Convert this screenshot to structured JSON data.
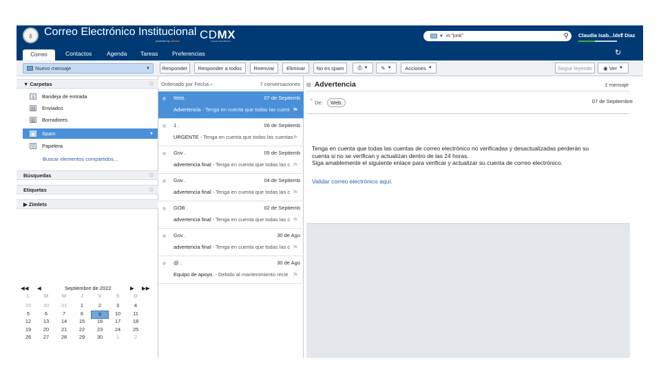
{
  "header": {
    "app_title": "Correo Electrónico Institucional",
    "powered_by": "powered by",
    "powered_brand": "zimbra",
    "cdmx_prefix": "CD",
    "cdmx_bold": "MX",
    "cdmx_sub": "CIUDAD DE MÉXICO",
    "search_value": "in:\"junk\"",
    "user_name": "Claudia Isab...ldez Diaz",
    "colors": {
      "brand": "#003a74",
      "selection": "#4a90d9",
      "link": "#2a5db0"
    }
  },
  "tabs": [
    "Correo",
    "Contactos",
    "Agenda",
    "Tareas",
    "Preferencias"
  ],
  "toolbar": {
    "new_message": "Nuevo mensaje",
    "reply": "Responder",
    "reply_all": "Responder a todos",
    "forward": "Reenviar",
    "delete": "Eliminar",
    "not_spam": "No es spam",
    "actions": "Acciones",
    "keep_reading": "Seguir leyendo",
    "view": "Ver"
  },
  "sidebar": {
    "folders_title": "Carpetas",
    "folders": [
      {
        "label": "Bandeja de entrada",
        "icon": "inbox-icon"
      },
      {
        "label": "Enviados",
        "icon": "sent-icon"
      },
      {
        "label": "Borradores",
        "icon": "drafts-icon"
      },
      {
        "label": "Spam",
        "icon": "spam-icon"
      },
      {
        "label": "Papelera",
        "icon": "trash-icon"
      }
    ],
    "shared": "Buscar elementos compartidos...",
    "searches": "Búsquedas",
    "tags": "Etiquetas",
    "zimlets": "Zimlets"
  },
  "calendar": {
    "month": "Septiembre de 2022",
    "dow": [
      "L",
      "M",
      "M",
      "J",
      "V",
      "S",
      "D"
    ],
    "weeks": [
      [
        "29",
        "30",
        "31",
        "1",
        "2",
        "3",
        "4"
      ],
      [
        "5",
        "6",
        "7",
        "8",
        "9",
        "10",
        "11"
      ],
      [
        "12",
        "13",
        "14",
        "15",
        "16",
        "17",
        "18"
      ],
      [
        "19",
        "20",
        "21",
        "22",
        "23",
        "24",
        "25"
      ],
      [
        "26",
        "27",
        "28",
        "29",
        "30",
        "1",
        "2"
      ]
    ],
    "selected": "9"
  },
  "list": {
    "sort_label": "Ordenado por Fecha",
    "count_label": "7 conversaciones",
    "messages": [
      {
        "from": "Web.",
        "date": "07 de Septiemb",
        "subject": "Advertencia",
        "snippet": " - Tenga en cuenta que todas las cuent"
      },
      {
        "from": "1 .",
        "date": "06 de Septiemb",
        "subject": "URGENTE",
        "snippet": " - Tenga en cuenta que todas las cuentas"
      },
      {
        "from": "Gov .",
        "date": "05 de Septiemb",
        "subject": "advertencia final",
        "snippet": " - Tenga en cuenta que todas las c"
      },
      {
        "from": "Gov .",
        "date": "04 de Septiemb",
        "subject": "advertencia final",
        "snippet": " - Tenga en cuenta que todas las c"
      },
      {
        "from": "GOB .",
        "date": "02 de Septiemb",
        "subject": "advertencia final",
        "snippet": " - Tenga en cuenta que todas las c"
      },
      {
        "from": "Gov .",
        "date": "30 de Ago",
        "subject": "advertencia final",
        "snippet": " - Tenga en cuenta que todas las c"
      },
      {
        "from": "@ .",
        "date": "30 de Ago",
        "subject": "Equipo de apoyo.",
        "snippet": " - Debido al mantenimiento recie"
      }
    ]
  },
  "reading": {
    "subject": "Advertencia",
    "count": "1 mensaje",
    "from_label": "De:",
    "from": "Web.",
    "date": "07 de Septiembre",
    "body_1": "Tenga en cuenta que todas las cuentas de correo electrónico no verificadas y desactualizadas perderán su",
    "body_2": "cuenta si no se verifican y actualizan dentro de las 24 horas.",
    "body_3": "Siga amablemente el siguiente enlace para verificar y actualizar su cuenta de correo electrónico.",
    "link": "Validar correo electrónico aquí."
  }
}
